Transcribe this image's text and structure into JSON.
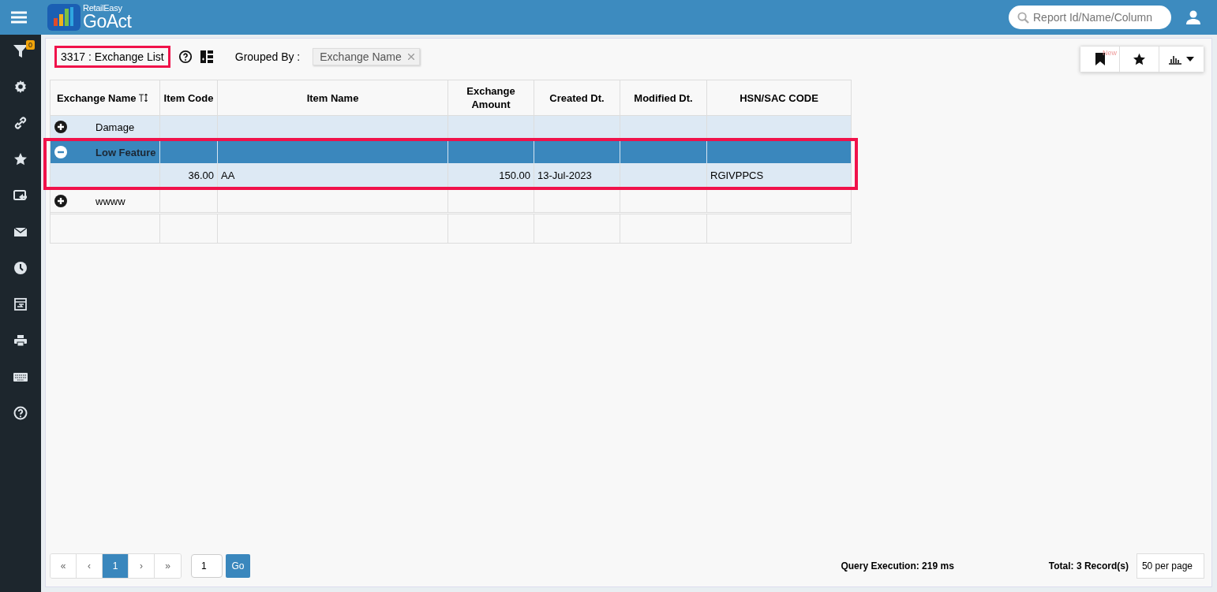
{
  "header": {
    "logo_small": "RetailEasy",
    "logo_large": "GoAct",
    "search": {
      "placeholder": "Report Id/Name/Column"
    }
  },
  "sidebar": {
    "filter_badge": "0"
  },
  "report": {
    "title": "3317 : Exchange List",
    "title_highlighted": true,
    "grouped_by_label": "Grouped By :",
    "group_chip": "Exchange Name"
  },
  "toolbar": {
    "bookmark_badge": "New"
  },
  "table": {
    "columns": [
      "Exchange Name",
      "Item Code",
      "Item Name",
      "Exchange Amount",
      "Created Dt.",
      "Modified Dt.",
      "HSN/SAC CODE"
    ],
    "groups": [
      {
        "name": "Damage",
        "expanded": false,
        "selected": false,
        "hovered": true,
        "highlighted": false
      },
      {
        "name": "Low Feature",
        "expanded": true,
        "selected": true,
        "highlighted": true,
        "rows": [
          {
            "item_code": "36.00",
            "item_name": "AA",
            "exchange_amount": "150.00",
            "created_dt": "13-Jul-2023",
            "hsn_sac_code": "RGIVPPCS"
          }
        ]
      },
      {
        "name": "wwww",
        "expanded": false,
        "selected": false,
        "hovered": false,
        "highlighted": false
      }
    ]
  },
  "pagination": {
    "pages": [
      {
        "label": "«",
        "selected": false
      },
      {
        "label": "‹",
        "selected": false
      },
      {
        "label": "1",
        "selected": true
      },
      {
        "label": "›",
        "selected": false
      },
      {
        "label": "»",
        "selected": false
      }
    ],
    "page_input": "1",
    "go": "Go"
  },
  "footer": {
    "query_execution": "Query Execution: 219 ms",
    "total": "Total: 3 Record(s)",
    "per_page": "50 per page"
  }
}
